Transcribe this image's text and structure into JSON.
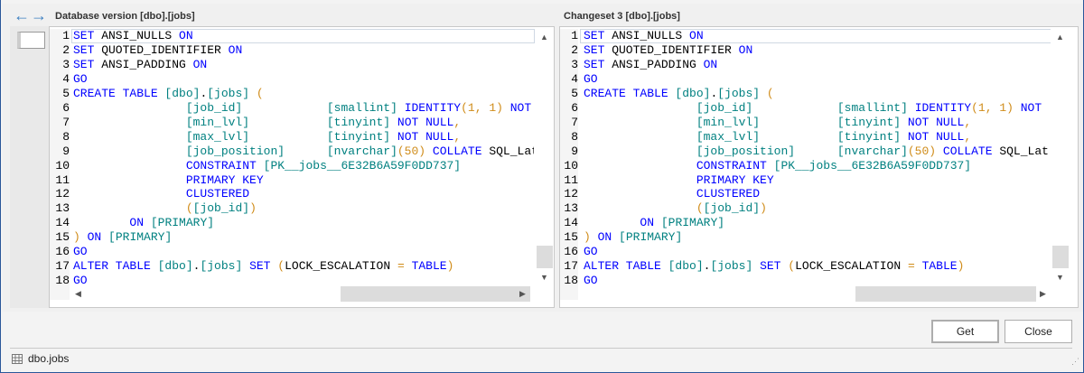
{
  "nav": {
    "back_icon": "arrow-left-icon",
    "forward_icon": "arrow-right-icon"
  },
  "left_panel": {
    "title": "Database version [dbo].[jobs]"
  },
  "right_panel": {
    "title": "Changeset 3 [dbo].[jobs]"
  },
  "code": [
    [
      [
        "kw",
        "SET"
      ],
      [
        "tx",
        " ANSI_NULLS "
      ],
      [
        "kw",
        "ON"
      ]
    ],
    [
      [
        "kw",
        "SET"
      ],
      [
        "tx",
        " QUOTED_IDENTIFIER "
      ],
      [
        "kw",
        "ON"
      ]
    ],
    [
      [
        "kw",
        "SET"
      ],
      [
        "tx",
        " ANSI_PADDING "
      ],
      [
        "kw",
        "ON"
      ]
    ],
    [
      [
        "kw",
        "GO"
      ]
    ],
    [
      [
        "kw",
        "CREATE TABLE "
      ],
      [
        "id",
        "[dbo]"
      ],
      [
        "tx",
        "."
      ],
      [
        "id",
        "[jobs]"
      ],
      [
        "tx",
        " "
      ],
      [
        "op",
        "("
      ]
    ],
    [
      [
        "tx",
        "                "
      ],
      [
        "id",
        "[job_id]"
      ],
      [
        "tx",
        "            "
      ],
      [
        "id",
        "[smallint]"
      ],
      [
        "tx",
        " "
      ],
      [
        "kw",
        "IDENTITY"
      ],
      [
        "op",
        "(1, 1)"
      ],
      [
        "tx",
        " "
      ],
      [
        "kw",
        "NOT"
      ]
    ],
    [
      [
        "tx",
        "                "
      ],
      [
        "id",
        "[min_lvl]"
      ],
      [
        "tx",
        "           "
      ],
      [
        "id",
        "[tinyint]"
      ],
      [
        "tx",
        " "
      ],
      [
        "kw",
        "NOT NULL"
      ],
      [
        "op",
        ","
      ]
    ],
    [
      [
        "tx",
        "                "
      ],
      [
        "id",
        "[max_lvl]"
      ],
      [
        "tx",
        "           "
      ],
      [
        "id",
        "[tinyint]"
      ],
      [
        "tx",
        " "
      ],
      [
        "kw",
        "NOT NULL"
      ],
      [
        "op",
        ","
      ]
    ],
    [
      [
        "tx",
        "                "
      ],
      [
        "id",
        "[job_position]"
      ],
      [
        "tx",
        "      "
      ],
      [
        "id",
        "[nvarchar]"
      ],
      [
        "op",
        "(50)"
      ],
      [
        "tx",
        " "
      ],
      [
        "kw",
        "COLLATE"
      ],
      [
        "tx",
        " SQL_Lat"
      ]
    ],
    [
      [
        "tx",
        "                "
      ],
      [
        "kw",
        "CONSTRAINT"
      ],
      [
        "tx",
        " "
      ],
      [
        "id",
        "[PK__jobs__6E32B6A59F0DD737]"
      ]
    ],
    [
      [
        "tx",
        "                "
      ],
      [
        "kw",
        "PRIMARY KEY"
      ]
    ],
    [
      [
        "tx",
        "                "
      ],
      [
        "kw",
        "CLUSTERED"
      ]
    ],
    [
      [
        "tx",
        "                "
      ],
      [
        "op",
        "("
      ],
      [
        "id",
        "[job_id]"
      ],
      [
        "op",
        ")"
      ]
    ],
    [
      [
        "tx",
        "        "
      ],
      [
        "kw",
        "ON"
      ],
      [
        "tx",
        " "
      ],
      [
        "id",
        "[PRIMARY]"
      ]
    ],
    [
      [
        "op",
        ")"
      ],
      [
        "tx",
        " "
      ],
      [
        "kw",
        "ON"
      ],
      [
        "tx",
        " "
      ],
      [
        "id",
        "[PRIMARY]"
      ]
    ],
    [
      [
        "kw",
        "GO"
      ]
    ],
    [
      [
        "kw",
        "ALTER TABLE "
      ],
      [
        "id",
        "[dbo]"
      ],
      [
        "tx",
        "."
      ],
      [
        "id",
        "[jobs]"
      ],
      [
        "tx",
        " "
      ],
      [
        "kw",
        "SET"
      ],
      [
        "tx",
        " "
      ],
      [
        "op",
        "("
      ],
      [
        "tx",
        "LOCK_ESCALATION "
      ],
      [
        "op",
        "="
      ],
      [
        "tx",
        " "
      ],
      [
        "kw",
        "TABLE"
      ],
      [
        "op",
        ")"
      ]
    ],
    [
      [
        "kw",
        "GO"
      ]
    ]
  ],
  "buttons": {
    "get": "Get",
    "close": "Close"
  },
  "status": {
    "object": "dbo.jobs"
  }
}
